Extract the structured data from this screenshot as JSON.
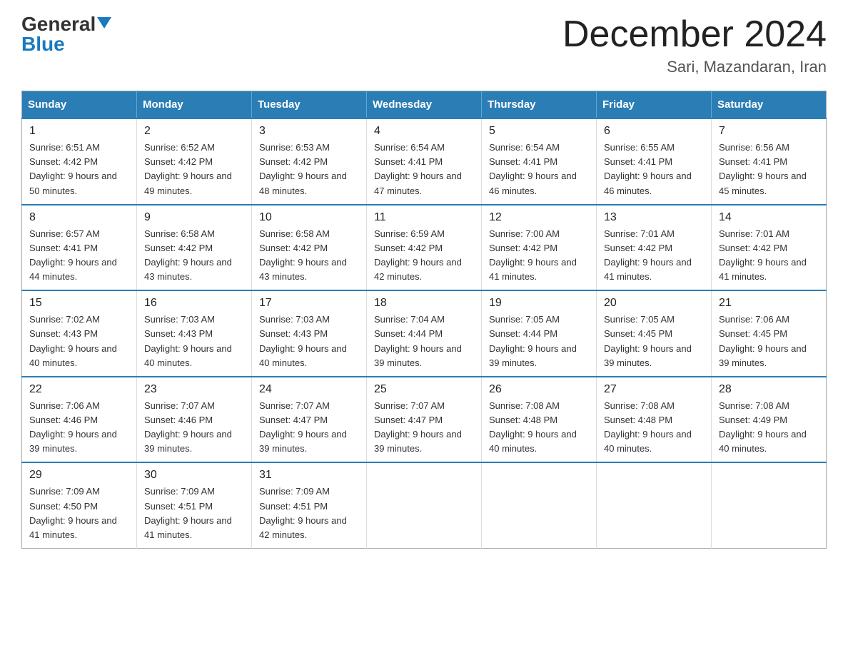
{
  "logo": {
    "general": "General",
    "blue": "Blue"
  },
  "title": "December 2024",
  "location": "Sari, Mazandaran, Iran",
  "days_of_week": [
    "Sunday",
    "Monday",
    "Tuesday",
    "Wednesday",
    "Thursday",
    "Friday",
    "Saturday"
  ],
  "weeks": [
    [
      {
        "day": "1",
        "sunrise": "6:51 AM",
        "sunset": "4:42 PM",
        "daylight": "9 hours and 50 minutes."
      },
      {
        "day": "2",
        "sunrise": "6:52 AM",
        "sunset": "4:42 PM",
        "daylight": "9 hours and 49 minutes."
      },
      {
        "day": "3",
        "sunrise": "6:53 AM",
        "sunset": "4:42 PM",
        "daylight": "9 hours and 48 minutes."
      },
      {
        "day": "4",
        "sunrise": "6:54 AM",
        "sunset": "4:41 PM",
        "daylight": "9 hours and 47 minutes."
      },
      {
        "day": "5",
        "sunrise": "6:54 AM",
        "sunset": "4:41 PM",
        "daylight": "9 hours and 46 minutes."
      },
      {
        "day": "6",
        "sunrise": "6:55 AM",
        "sunset": "4:41 PM",
        "daylight": "9 hours and 46 minutes."
      },
      {
        "day": "7",
        "sunrise": "6:56 AM",
        "sunset": "4:41 PM",
        "daylight": "9 hours and 45 minutes."
      }
    ],
    [
      {
        "day": "8",
        "sunrise": "6:57 AM",
        "sunset": "4:41 PM",
        "daylight": "9 hours and 44 minutes."
      },
      {
        "day": "9",
        "sunrise": "6:58 AM",
        "sunset": "4:42 PM",
        "daylight": "9 hours and 43 minutes."
      },
      {
        "day": "10",
        "sunrise": "6:58 AM",
        "sunset": "4:42 PM",
        "daylight": "9 hours and 43 minutes."
      },
      {
        "day": "11",
        "sunrise": "6:59 AM",
        "sunset": "4:42 PM",
        "daylight": "9 hours and 42 minutes."
      },
      {
        "day": "12",
        "sunrise": "7:00 AM",
        "sunset": "4:42 PM",
        "daylight": "9 hours and 41 minutes."
      },
      {
        "day": "13",
        "sunrise": "7:01 AM",
        "sunset": "4:42 PM",
        "daylight": "9 hours and 41 minutes."
      },
      {
        "day": "14",
        "sunrise": "7:01 AM",
        "sunset": "4:42 PM",
        "daylight": "9 hours and 41 minutes."
      }
    ],
    [
      {
        "day": "15",
        "sunrise": "7:02 AM",
        "sunset": "4:43 PM",
        "daylight": "9 hours and 40 minutes."
      },
      {
        "day": "16",
        "sunrise": "7:03 AM",
        "sunset": "4:43 PM",
        "daylight": "9 hours and 40 minutes."
      },
      {
        "day": "17",
        "sunrise": "7:03 AM",
        "sunset": "4:43 PM",
        "daylight": "9 hours and 40 minutes."
      },
      {
        "day": "18",
        "sunrise": "7:04 AM",
        "sunset": "4:44 PM",
        "daylight": "9 hours and 39 minutes."
      },
      {
        "day": "19",
        "sunrise": "7:05 AM",
        "sunset": "4:44 PM",
        "daylight": "9 hours and 39 minutes."
      },
      {
        "day": "20",
        "sunrise": "7:05 AM",
        "sunset": "4:45 PM",
        "daylight": "9 hours and 39 minutes."
      },
      {
        "day": "21",
        "sunrise": "7:06 AM",
        "sunset": "4:45 PM",
        "daylight": "9 hours and 39 minutes."
      }
    ],
    [
      {
        "day": "22",
        "sunrise": "7:06 AM",
        "sunset": "4:46 PM",
        "daylight": "9 hours and 39 minutes."
      },
      {
        "day": "23",
        "sunrise": "7:07 AM",
        "sunset": "4:46 PM",
        "daylight": "9 hours and 39 minutes."
      },
      {
        "day": "24",
        "sunrise": "7:07 AM",
        "sunset": "4:47 PM",
        "daylight": "9 hours and 39 minutes."
      },
      {
        "day": "25",
        "sunrise": "7:07 AM",
        "sunset": "4:47 PM",
        "daylight": "9 hours and 39 minutes."
      },
      {
        "day": "26",
        "sunrise": "7:08 AM",
        "sunset": "4:48 PM",
        "daylight": "9 hours and 40 minutes."
      },
      {
        "day": "27",
        "sunrise": "7:08 AM",
        "sunset": "4:48 PM",
        "daylight": "9 hours and 40 minutes."
      },
      {
        "day": "28",
        "sunrise": "7:08 AM",
        "sunset": "4:49 PM",
        "daylight": "9 hours and 40 minutes."
      }
    ],
    [
      {
        "day": "29",
        "sunrise": "7:09 AM",
        "sunset": "4:50 PM",
        "daylight": "9 hours and 41 minutes."
      },
      {
        "day": "30",
        "sunrise": "7:09 AM",
        "sunset": "4:51 PM",
        "daylight": "9 hours and 41 minutes."
      },
      {
        "day": "31",
        "sunrise": "7:09 AM",
        "sunset": "4:51 PM",
        "daylight": "9 hours and 42 minutes."
      },
      null,
      null,
      null,
      null
    ]
  ]
}
